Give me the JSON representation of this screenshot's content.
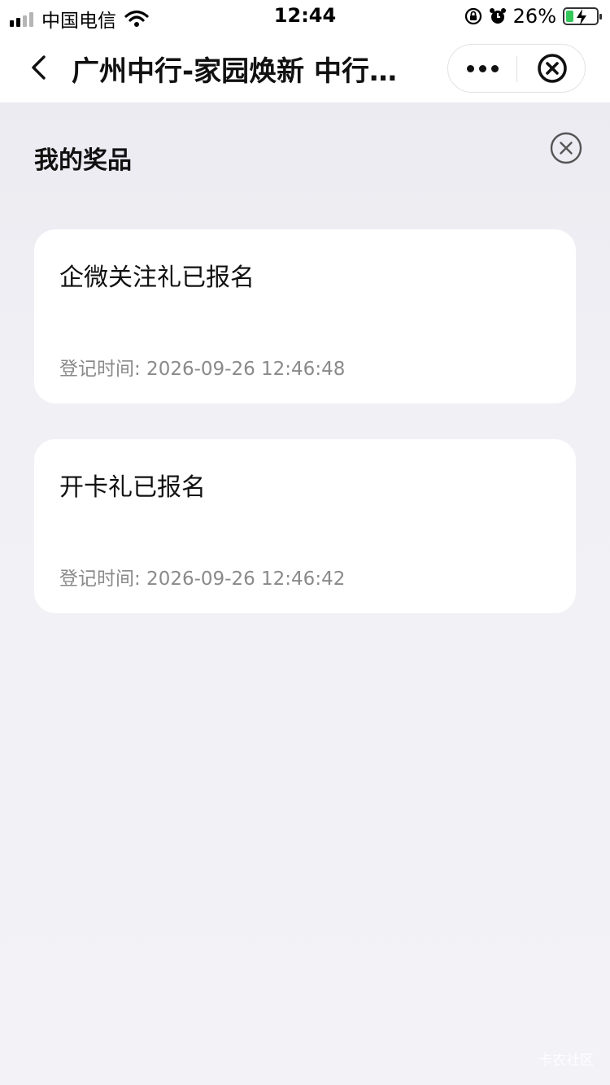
{
  "status_bar": {
    "carrier": "中国电信",
    "time": "12:44",
    "battery_percent": "26%",
    "battery_level": 0.26
  },
  "nav": {
    "title": "广州中行-家园焕新 中行…",
    "icons": [
      "back-arrow-icon",
      "more-dots-icon",
      "close-circle-icon"
    ]
  },
  "panel": {
    "title": "我的奖品",
    "close_icon": "close-circle-icon"
  },
  "prizes": [
    {
      "title": "企微关注礼已报名",
      "time": "登记时间: 2026-09-26 12:46:48"
    },
    {
      "title": "开卡礼已报名",
      "time": "登记时间: 2026-09-26 12:46:42"
    }
  ],
  "watermark": "卡农社区",
  "colors": {
    "background": "#f0f0f5",
    "card": "#ffffff",
    "muted_text": "#8a8a8a",
    "battery": "#34c759"
  }
}
